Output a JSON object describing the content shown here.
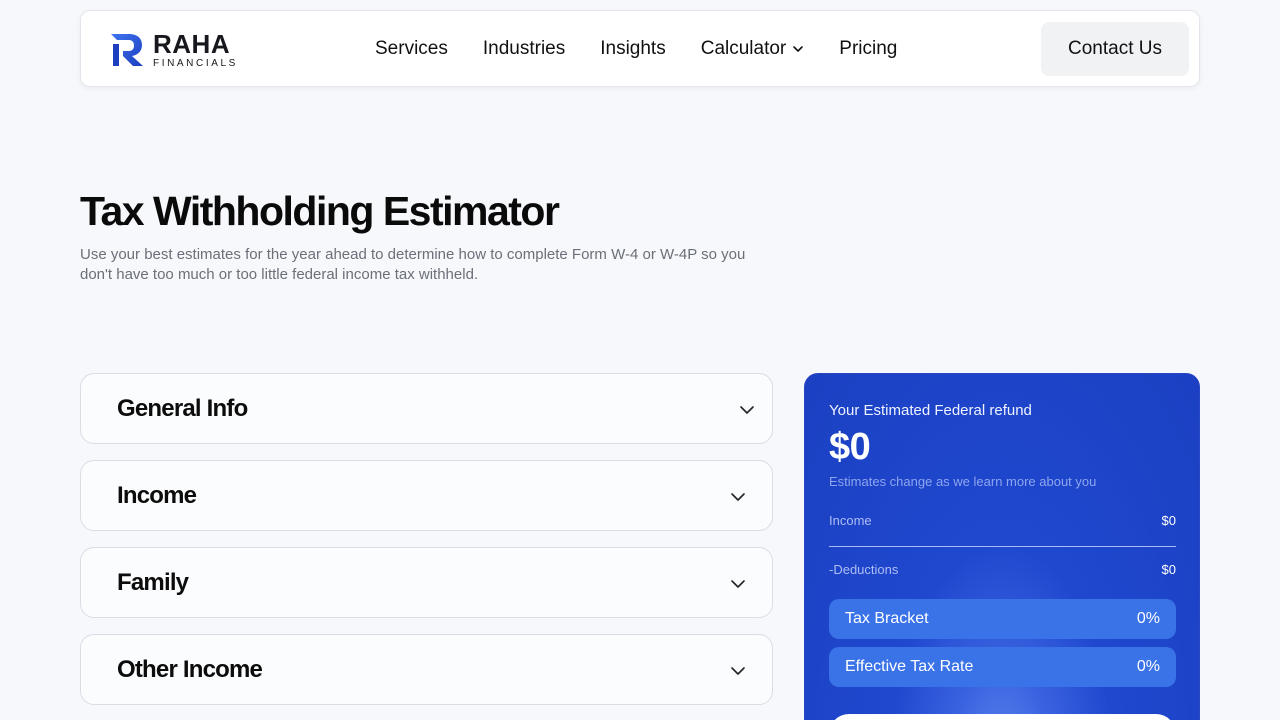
{
  "brand": {
    "name": "RAHA",
    "tagline": "FINANCIALS",
    "color": "#2b5bdc"
  },
  "nav": {
    "links": [
      "Services",
      "Industries",
      "Insights",
      "Calculator",
      "Pricing"
    ],
    "contact_label": "Contact Us"
  },
  "hero": {
    "title": "Tax Withholding Estimator",
    "description": "Use your best estimates for the year ahead to determine how to complete Form W-4 or W-4P so you don't have too much or too little federal income tax withheld."
  },
  "sections": [
    "General Info",
    "Income",
    "Family",
    "Other Income"
  ],
  "result": {
    "label": "Your Estimated Federal refund",
    "amount": "$0",
    "note": "Estimates change as we learn more about you",
    "income_label": "Income",
    "income_value": "$0",
    "deductions_label": "-Deductions",
    "deductions_value": "$0",
    "tax_bracket_label": "Tax Bracket",
    "tax_bracket_value": "0%",
    "effective_rate_label": "Effective Tax Rate",
    "effective_rate_value": "0%"
  },
  "icons": [
    "chevron-down-icon",
    "raha-logo-icon"
  ],
  "colors": {
    "card_blue": "#1f48cf",
    "pill_blue": "#3a72e8",
    "page_bg": "#f6f8fb"
  }
}
